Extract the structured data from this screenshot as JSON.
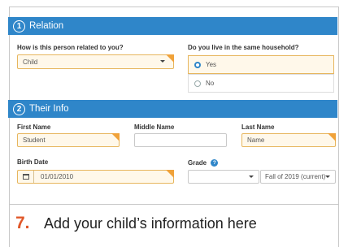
{
  "relation": {
    "number": "1",
    "title": "Relation",
    "question_relationship": "How is this person related to you?",
    "relationship_value": "Child",
    "question_household": "Do you live in the same household?",
    "options": [
      "Yes",
      "No"
    ],
    "selected_option": "Yes"
  },
  "info": {
    "number": "2",
    "title": "Their Info",
    "first_name_label": "First Name",
    "first_name_value": "Student",
    "middle_name_label": "Middle Name",
    "middle_name_value": "",
    "last_name_label": "Last Name",
    "last_name_value": "Name",
    "birth_date_label": "Birth Date",
    "birth_date_value": "01/01/2010",
    "grade_label": "Grade",
    "grade_value": "",
    "term_value": "Fall of 2019 (current)"
  },
  "caption": {
    "step": "7.",
    "text": "Add your child’s information here"
  },
  "colors": {
    "header": "#2f86c9",
    "required": "#f0a23a",
    "step": "#e0582a"
  }
}
